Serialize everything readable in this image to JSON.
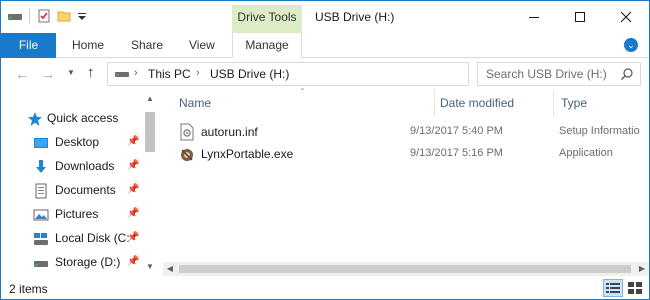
{
  "window": {
    "title": "USB Drive (H:)",
    "context_tab_group": "Drive Tools"
  },
  "ribbon": {
    "tabs": [
      {
        "label": "File",
        "active": true
      },
      {
        "label": "Home"
      },
      {
        "label": "Share"
      },
      {
        "label": "View"
      },
      {
        "label": "Manage"
      }
    ]
  },
  "address": {
    "crumbs": [
      "This PC",
      "USB Drive (H:)"
    ]
  },
  "search": {
    "placeholder": "Search USB Drive (H:)"
  },
  "nav_pane": {
    "items": [
      {
        "label": "Quick access",
        "icon": "star-icon",
        "pinned": false
      },
      {
        "label": "Desktop",
        "icon": "desktop-folder-icon",
        "pinned": true
      },
      {
        "label": "Downloads",
        "icon": "downloads-folder-icon",
        "pinned": true
      },
      {
        "label": "Documents",
        "icon": "documents-folder-icon",
        "pinned": true
      },
      {
        "label": "Pictures",
        "icon": "pictures-folder-icon",
        "pinned": true
      },
      {
        "label": "Local Disk (C:",
        "icon": "local-disk-icon",
        "pinned": true
      },
      {
        "label": "Storage (D:)",
        "icon": "drive-icon",
        "pinned": true
      }
    ]
  },
  "file_list": {
    "columns": [
      "Name",
      "Date modified",
      "Type"
    ],
    "rows": [
      {
        "name": "autorun.inf",
        "date": "9/13/2017 5:40 PM",
        "type": "Setup Informatio",
        "icon": "inf-file-icon"
      },
      {
        "name": "LynxPortable.exe",
        "date": "9/13/2017 5:16 PM",
        "type": "Application",
        "icon": "exe-file-icon"
      }
    ]
  },
  "status": {
    "count": "2 items"
  },
  "colors": {
    "accent": "#1979ca",
    "context_tab": "#dcecc4"
  }
}
